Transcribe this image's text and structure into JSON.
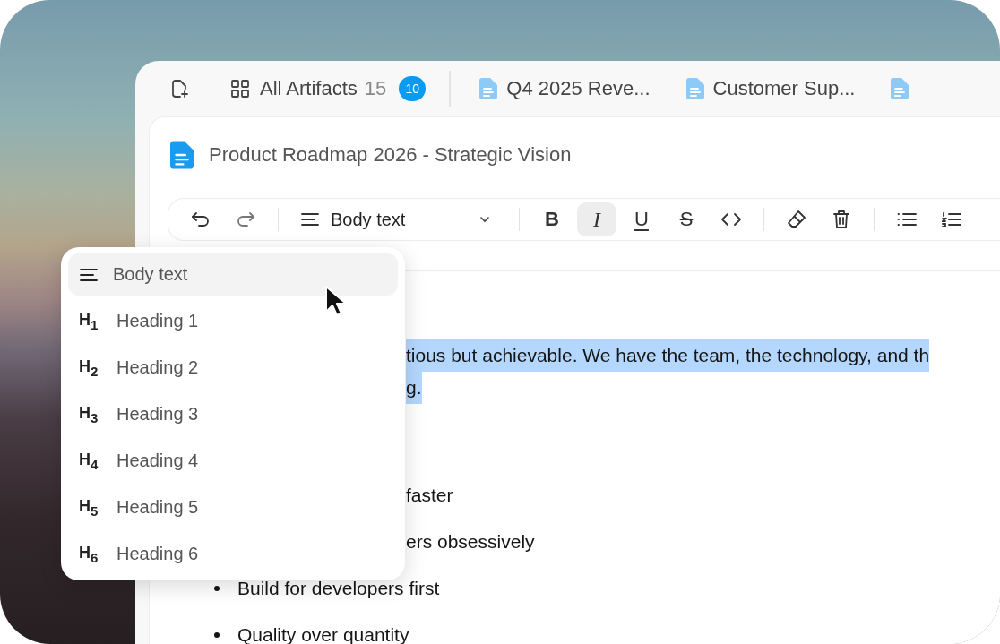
{
  "tab_bar": {
    "tabs": [
      {
        "kind": "new"
      },
      {
        "kind": "grid",
        "label": "All Artifacts",
        "count": "15",
        "badge": "10"
      },
      {
        "kind": "doc",
        "label": "Q4 2025 Reve..."
      },
      {
        "kind": "doc",
        "label": "Customer Sup..."
      },
      {
        "kind": "doc"
      }
    ]
  },
  "document": {
    "title": "Product Roadmap 2026 - Strategic Vision"
  },
  "toolbar": [
    {
      "kind": "undo",
      "selected": false
    },
    {
      "kind": "redo",
      "selected": false
    },
    {
      "kind": "divider"
    },
    {
      "kind": "dropdown",
      "label": "Body text"
    },
    {
      "kind": "divider"
    },
    {
      "kind": "bold",
      "glyph": "B",
      "selected": false
    },
    {
      "kind": "italic",
      "glyph": "I",
      "selected": true
    },
    {
      "kind": "underline",
      "glyph": "U",
      "selected": false
    },
    {
      "kind": "strike",
      "glyph": "S",
      "selected": false
    },
    {
      "kind": "code",
      "selected": false
    },
    {
      "kind": "divider"
    },
    {
      "kind": "eraser",
      "selected": false
    },
    {
      "kind": "trash",
      "selected": false
    },
    {
      "kind": "divider"
    },
    {
      "kind": "bullets",
      "selected": false
    },
    {
      "kind": "numbers",
      "selected": false
    }
  ],
  "content": [
    {
      "kind": "fragment",
      "text": "tious but achievable. We have the team, the technology, and th",
      "highlighted": true
    },
    {
      "kind": "fragment",
      "text": "g.",
      "highlighted": true
    },
    {
      "kind": "fragment",
      "text": "faster",
      "highlighted": false
    },
    {
      "kind": "fragment",
      "text": "ers obsessively",
      "highlighted": false
    },
    {
      "kind": "bullet",
      "text": "Build for developers first",
      "highlighted": false
    },
    {
      "kind": "bullet",
      "text": "Quality over quantity",
      "highlighted": false
    }
  ],
  "block_menu": {
    "items": [
      {
        "kind": "paragraph",
        "label": "Body text",
        "selected": true
      },
      {
        "kind": "heading",
        "marker": "H$_{1}$",
        "label": "Heading 1",
        "selected": false
      },
      {
        "kind": "heading",
        "marker": "H$_{2}$",
        "label": "Heading 2",
        "selected": false
      },
      {
        "kind": "heading",
        "marker": "H$_{3}$",
        "label": "Heading 3",
        "selected": false
      },
      {
        "kind": "heading",
        "marker": "H$_{4}$",
        "label": "Heading 4",
        "selected": false
      },
      {
        "kind": "heading",
        "marker": "H$_{5}$",
        "label": "Heading 5",
        "selected": false
      },
      {
        "kind": "heading",
        "marker": "H$_{6}$",
        "label": "Heading 6",
        "selected": false
      }
    ]
  }
}
